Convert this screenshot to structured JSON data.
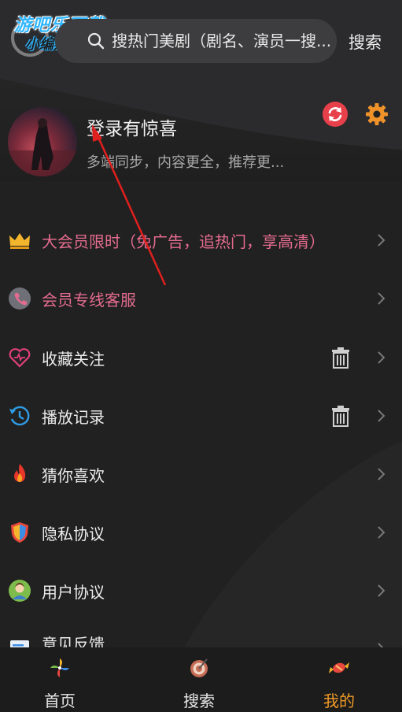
{
  "watermark": {
    "line1": "游吧乐下载",
    "line2": "小编亲测"
  },
  "search": {
    "placeholder": "搜热门美剧（剧名、演员一搜...",
    "button_label": "搜索",
    "icon": "search-icon"
  },
  "profile": {
    "title": "登录有惊喜",
    "subtitle": "多端同步，内容更全，推荐更...",
    "sync_icon": "sync-icon",
    "settings_icon": "gear-icon"
  },
  "menu": {
    "items": [
      {
        "label": "大会员限时（免广告，追热门，享高清）",
        "icon": "crown-icon",
        "highlight": true,
        "trash": false
      },
      {
        "label": "会员专线客服",
        "icon": "phone-icon",
        "highlight": true,
        "trash": false
      },
      {
        "label": "收藏关注",
        "icon": "heart-icon",
        "highlight": false,
        "trash": true
      },
      {
        "label": "播放记录",
        "icon": "history-icon",
        "highlight": false,
        "trash": true
      },
      {
        "label": "猜你喜欢",
        "icon": "flame-icon",
        "highlight": false,
        "trash": false
      },
      {
        "label": "隐私协议",
        "icon": "shield-icon",
        "highlight": false,
        "trash": false
      },
      {
        "label": "用户协议",
        "icon": "user-icon",
        "highlight": false,
        "trash": false
      },
      {
        "label": "意见反馈",
        "icon": "feedback-icon",
        "highlight": false,
        "trash": false
      }
    ]
  },
  "bottom_nav": {
    "items": [
      {
        "label": "首页",
        "icon": "pinwheel-icon",
        "active": false
      },
      {
        "label": "搜索",
        "icon": "target-icon",
        "active": false
      },
      {
        "label": "我的",
        "icon": "candy-icon",
        "active": true
      }
    ]
  },
  "colors": {
    "accent_pink": "#e46b8f",
    "accent_orange": "#f09a27",
    "annotation_red": "#e0201e"
  }
}
